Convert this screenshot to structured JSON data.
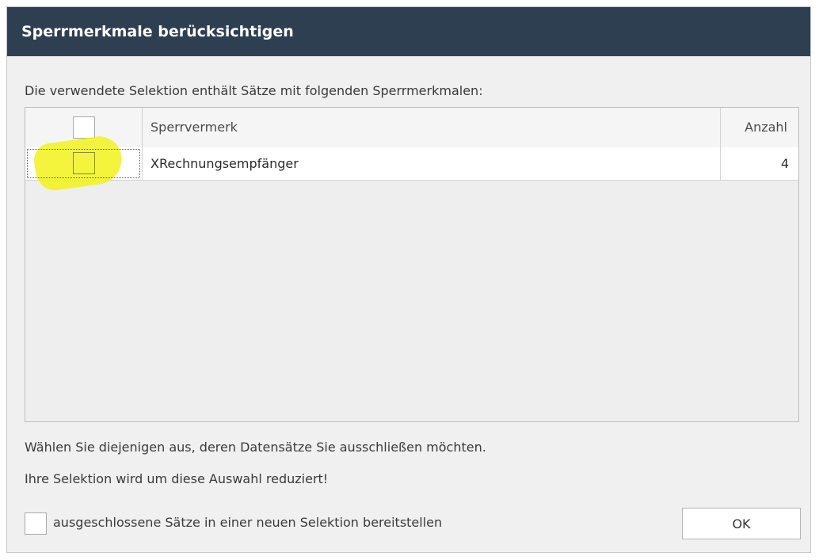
{
  "dialog": {
    "title": "Sperrmerkmale berücksichtigen",
    "intro": "Die verwendete Selektion enthält Sätze mit folgenden Sperrmerkmalen:",
    "hint_line1": "Wählen Sie diejenigen aus, deren Datensätze Sie ausschließen möchten.",
    "hint_line2": "Ihre Selektion wird um diese Auswahl reduziert!",
    "bottom_checkbox_label": "ausgeschlossene Sätze in einer neuen Selektion bereitstellen",
    "ok_label": "OK"
  },
  "grid": {
    "columns": {
      "name": "Sperrvermerk",
      "count": "Anzahl"
    },
    "rows": [
      {
        "name": "XRechnungsempfänger",
        "count": "4",
        "checked": false
      }
    ]
  },
  "colors": {
    "titlebar": "#2e3f52",
    "highlight": "#f2f21a"
  }
}
